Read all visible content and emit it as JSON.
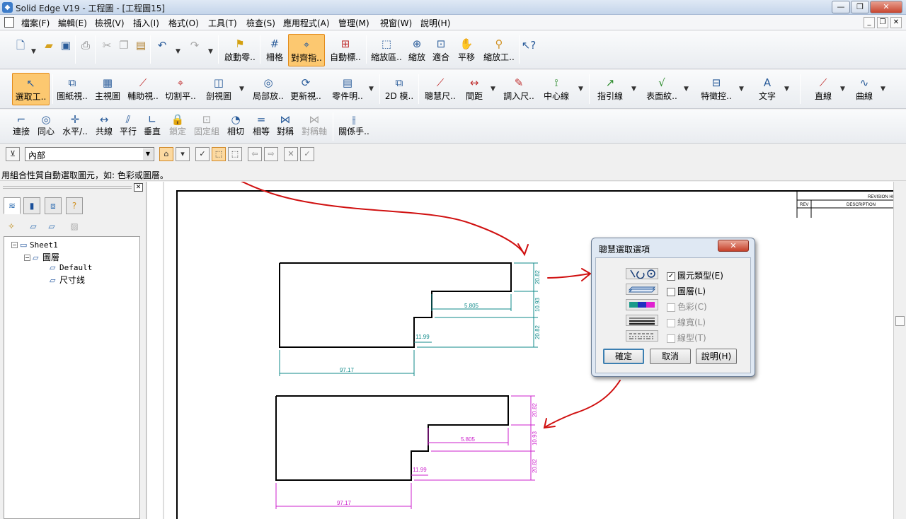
{
  "title": "Solid Edge V19 - 工程圖 - [工程圖15]",
  "menu": [
    "檔案(F)",
    "編輯(E)",
    "檢視(V)",
    "插入(I)",
    "格式(O)",
    "工具(T)",
    "檢查(S)",
    "應用程式(A)",
    "管理(M)",
    "視窗(W)",
    "說明(H)"
  ],
  "toolbar1": {
    "startup": "啟動零..",
    "grid": "柵格",
    "align": "對齊指..",
    "autoscale": "自動標..",
    "zoomarea": "縮放區..",
    "zoom": "縮放",
    "fit": "適合",
    "pan": "平移",
    "zoomtool": "縮放工.."
  },
  "toolbar2": {
    "select": "選取工..",
    "sheetview": "圖紙視..",
    "mainview": "主視圖",
    "auxview": "輔助視..",
    "cutplane": "切割平..",
    "section": "剖視圖",
    "detail": "局部放..",
    "update": "更新視..",
    "partlist": "零件明..",
    "twod": "2D 模..",
    "smartdim": "聰慧尺..",
    "distance": "間距",
    "retrieve": "調入尺..",
    "centerline": "中心線",
    "leader": "指引線",
    "surface": "表面紋..",
    "feature": "特徵控..",
    "text": "文字",
    "line": "直線",
    "curve": "曲線"
  },
  "toolbar3": {
    "connect": "連接",
    "concentric": "同心",
    "horizontal": "水平/..",
    "collinear": "共線",
    "parallel": "平行",
    "perpendicular": "垂直",
    "lock": "鎖定",
    "fixset": "固定組",
    "tangent": "相切",
    "equal": "相等",
    "symmetric": "對稱",
    "symaxis": "對稱軸",
    "relation": "關係手.."
  },
  "select_combo": "內部",
  "status": "用組合性質自動選取圖元，如: 色彩或圖層。",
  "tree": {
    "sheet": "Sheet1",
    "layers": "圖層",
    "default": "Default",
    "dim": "尺寸线"
  },
  "titleblock": {
    "revision": "REVISION HIS",
    "rev": "REV",
    "desc": "DESCRIPTION"
  },
  "dims": {
    "d1": "20.82",
    "d2": "10.93",
    "d3": "5.805",
    "d4": "20.82",
    "d5": "11.99",
    "d6": "97.17"
  },
  "dialog": {
    "title": "聰慧選取選項",
    "close": "✕",
    "opt1": "圖元類型(E)",
    "opt2": "圖層(L)",
    "opt3": "色彩(C)",
    "opt4": "線寬(L)",
    "opt5": "線型(T)",
    "ok": "確定",
    "cancel": "取消",
    "help": "說明(H)"
  },
  "colors": {
    "dim_top": "#0f8a8a",
    "dim_bottom": "#cc22cc",
    "annotation": "#d01010",
    "active": "#fcc870"
  }
}
